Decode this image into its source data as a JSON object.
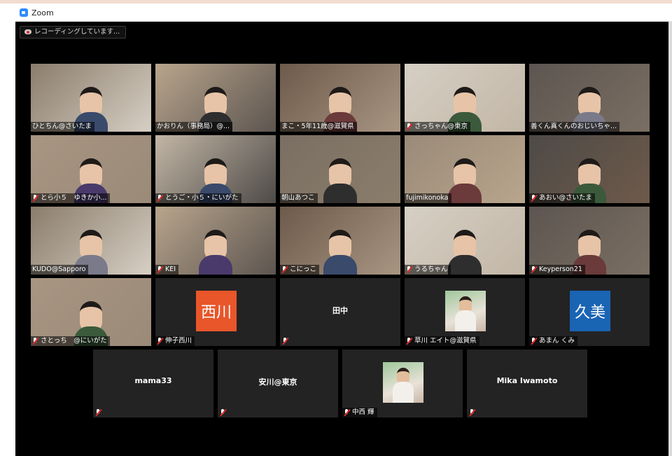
{
  "window": {
    "title": "Zoom"
  },
  "recording": {
    "label": "レコーディングしています..."
  },
  "colors": {
    "active_border": "#c8e55a",
    "initials_orange": "#e8562a",
    "initials_blue": "#1a64b4",
    "stage": "#000000",
    "tile": "#232323"
  },
  "participants": [
    {
      "name": "ひとちん@さいたま",
      "muted": false,
      "type": "video"
    },
    {
      "name": "かおりん（事務局）@...",
      "muted": false,
      "type": "video"
    },
    {
      "name": "まこ・5年11歳@滋賀県",
      "muted": false,
      "type": "video",
      "active": true
    },
    {
      "name": "さっちゃん@東京",
      "muted": true,
      "type": "video"
    },
    {
      "name": "善くん真くんのおじいちゃ...",
      "muted": false,
      "type": "video"
    },
    {
      "name": "とら小５　ゆきか小...",
      "muted": true,
      "type": "video"
    },
    {
      "name": "とうご・小５・にいがた",
      "muted": true,
      "type": "video"
    },
    {
      "name": "朝山あつこ",
      "muted": false,
      "type": "video"
    },
    {
      "name": "fujimikonoka",
      "muted": false,
      "type": "video"
    },
    {
      "name": "あおい@さいたま",
      "muted": true,
      "type": "video"
    },
    {
      "name": "KUDO@Sapporo",
      "muted": false,
      "type": "video"
    },
    {
      "name": "KEI",
      "muted": true,
      "type": "video"
    },
    {
      "name": "こにっこ",
      "muted": true,
      "type": "video"
    },
    {
      "name": "うるちゃん",
      "muted": true,
      "type": "video"
    },
    {
      "name": "Keyperson21",
      "muted": true,
      "type": "video"
    },
    {
      "name": "さとっち　@にいがた",
      "muted": true,
      "type": "video"
    },
    {
      "name": "伸子西川",
      "muted": true,
      "type": "initials",
      "initials": "西川",
      "color": "#e8562a"
    },
    {
      "name": "田中",
      "muted": true,
      "type": "nameonly"
    },
    {
      "name": "草川 エイト@滋賀県",
      "muted": true,
      "type": "photo"
    },
    {
      "name": "あまん くみ",
      "muted": true,
      "type": "initials",
      "initials": "久美",
      "color": "#1a64b4"
    },
    {
      "name": "mama33",
      "muted": true,
      "type": "nameonly"
    },
    {
      "name": "安川@東京",
      "muted": true,
      "type": "nameonly"
    },
    {
      "name": "中西 輝",
      "muted": true,
      "type": "photo"
    },
    {
      "name": "Mika Iwamoto",
      "muted": true,
      "type": "nameonly"
    }
  ]
}
